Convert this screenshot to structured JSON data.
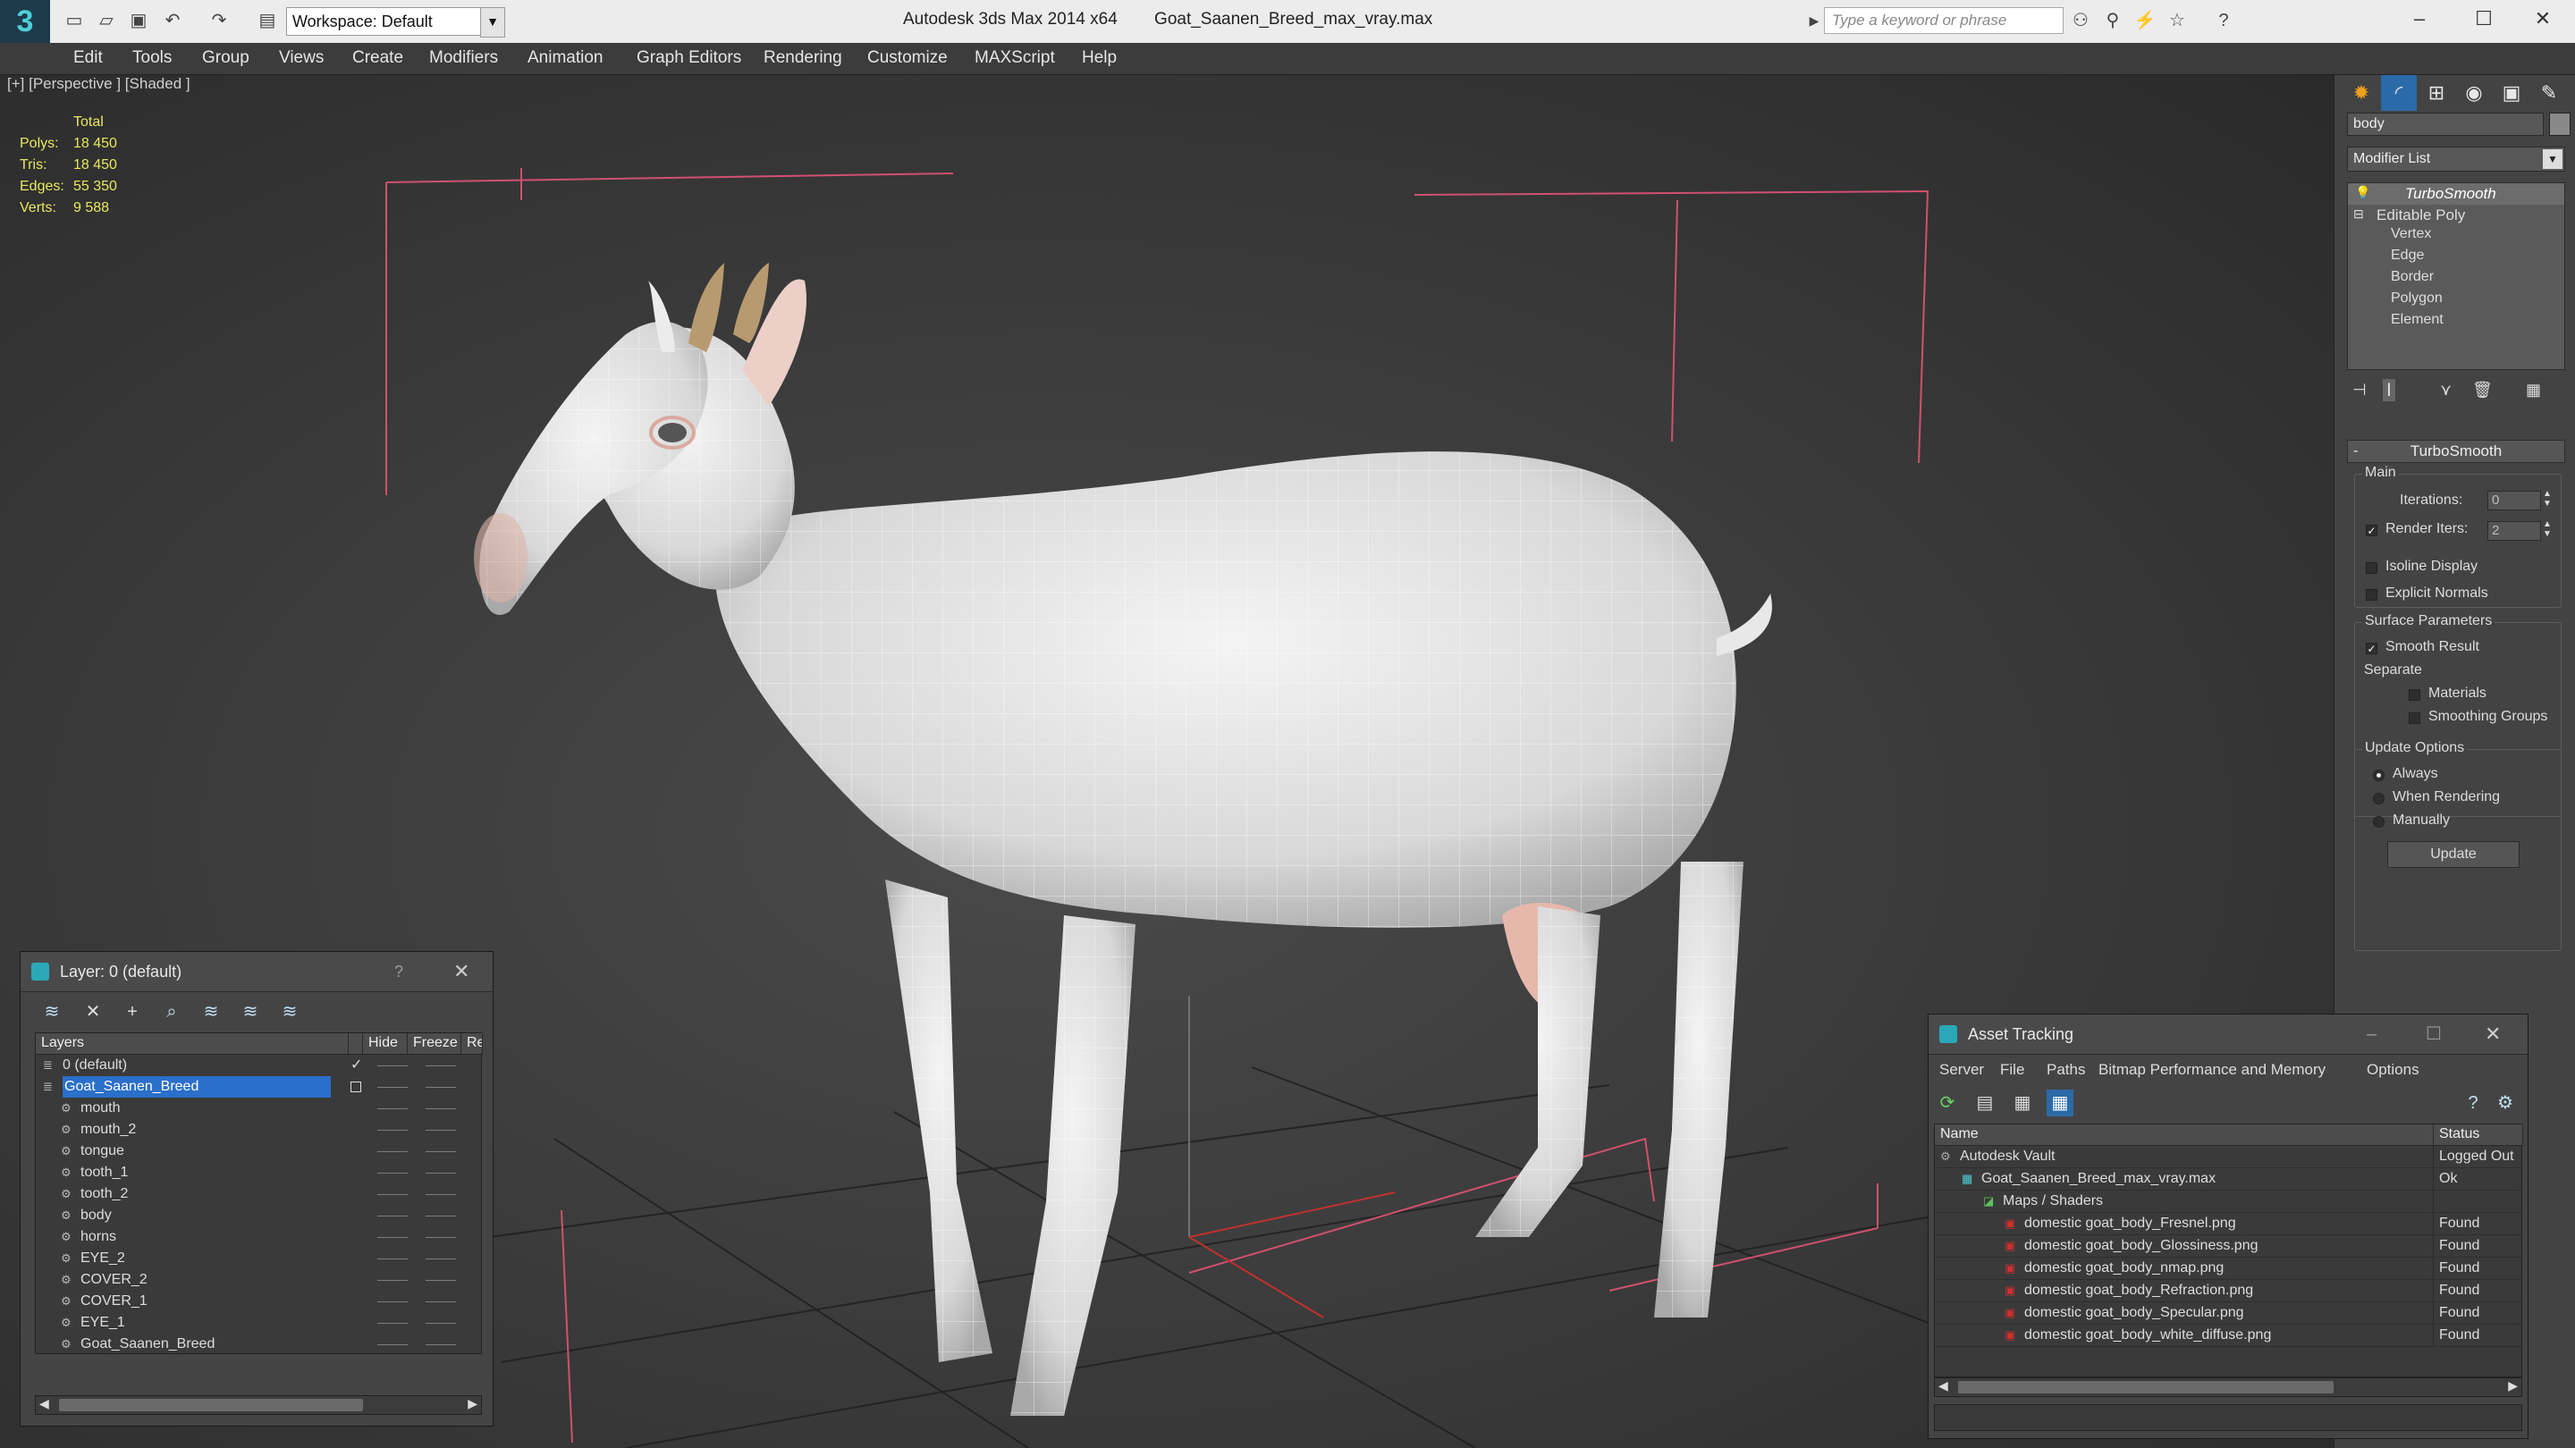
{
  "titlebar": {
    "app": "Autodesk 3ds Max  2014 x64",
    "file": "Goat_Saanen_Breed_max_vray.max",
    "workspace": "Workspace: Default",
    "search_placeholder": "Type a keyword or phrase"
  },
  "menu": [
    "Edit",
    "Tools",
    "Group",
    "Views",
    "Create",
    "Modifiers",
    "Animation",
    "Graph Editors",
    "Rendering",
    "Customize",
    "MAXScript",
    "Help"
  ],
  "viewport": {
    "label": "[+] [Perspective ] [Shaded ]",
    "stats": {
      "header": "Total",
      "rows": [
        {
          "label": "Polys:",
          "value": "18 450"
        },
        {
          "label": "Tris:",
          "value": "18 450"
        },
        {
          "label": "Edges:",
          "value": "55 350"
        },
        {
          "label": "Verts:",
          "value": "9 588"
        }
      ]
    }
  },
  "command_panel": {
    "object_name": "body",
    "modifier_list": "Modifier List",
    "stack": [
      {
        "label": "TurboSmooth",
        "level": 0,
        "italic": true
      },
      {
        "label": "Editable Poly",
        "level": 0
      },
      {
        "label": "Vertex",
        "level": 1
      },
      {
        "label": "Edge",
        "level": 1
      },
      {
        "label": "Border",
        "level": 1
      },
      {
        "label": "Polygon",
        "level": 1
      },
      {
        "label": "Element",
        "level": 1
      }
    ],
    "rollout_title": "TurboSmooth",
    "main_group": "Main",
    "iterations_label": "Iterations:",
    "iterations_value": "0",
    "render_iters_label": "Render Iters:",
    "render_iters_value": "2",
    "isoline_label": "Isoline Display",
    "explicit_normals_label": "Explicit Normals",
    "surface_group": "Surface Parameters",
    "smooth_result_label": "Smooth Result",
    "separate_label": "Separate",
    "materials_label": "Materials",
    "smoothing_groups_label": "Smoothing Groups",
    "update_group": "Update Options",
    "always_label": "Always",
    "when_rendering_label": "When Rendering",
    "manually_label": "Manually",
    "update_button": "Update"
  },
  "layer_window": {
    "title": "Layer: 0 (default)",
    "help": "?",
    "columns": [
      "Layers",
      "Hide",
      "Freeze",
      "Re"
    ],
    "rows": [
      {
        "name": "0 (default)",
        "level": 0,
        "type": "layer",
        "current": true
      },
      {
        "name": "Goat_Saanen_Breed",
        "level": 0,
        "type": "layer",
        "selected": true
      },
      {
        "name": "mouth",
        "level": 1,
        "type": "object"
      },
      {
        "name": "mouth_2",
        "level": 1,
        "type": "object"
      },
      {
        "name": "tongue",
        "level": 1,
        "type": "object"
      },
      {
        "name": "tooth_1",
        "level": 1,
        "type": "object"
      },
      {
        "name": "tooth_2",
        "level": 1,
        "type": "object"
      },
      {
        "name": "body",
        "level": 1,
        "type": "object"
      },
      {
        "name": "horns",
        "level": 1,
        "type": "object"
      },
      {
        "name": "EYE_2",
        "level": 1,
        "type": "object"
      },
      {
        "name": "COVER_2",
        "level": 1,
        "type": "object"
      },
      {
        "name": "COVER_1",
        "level": 1,
        "type": "object"
      },
      {
        "name": "EYE_1",
        "level": 1,
        "type": "object"
      },
      {
        "name": "Goat_Saanen_Breed",
        "level": 1,
        "type": "object"
      }
    ]
  },
  "asset_window": {
    "title": "Asset Tracking",
    "menu": [
      "Server",
      "File",
      "Paths",
      "Bitmap Performance and Memory",
      "Options"
    ],
    "columns": [
      "Name",
      "Status"
    ],
    "rows": [
      {
        "name": "Autodesk Vault",
        "status": "Logged Out",
        "level": 0
      },
      {
        "name": "Goat_Saanen_Breed_max_vray.max",
        "status": "Ok",
        "level": 1
      },
      {
        "name": "Maps / Shaders",
        "status": "",
        "level": 2
      },
      {
        "name": "domestic goat_body_Fresnel.png",
        "status": "Found",
        "level": 3
      },
      {
        "name": "domestic goat_body_Glossiness.png",
        "status": "Found",
        "level": 3
      },
      {
        "name": "domestic goat_body_nmap.png",
        "status": "Found",
        "level": 3
      },
      {
        "name": "domestic goat_body_Refraction.png",
        "status": "Found",
        "level": 3
      },
      {
        "name": "domestic goat_body_Specular.png",
        "status": "Found",
        "level": 3
      },
      {
        "name": "domestic goat_body_white_diffuse.png",
        "status": "Found",
        "level": 3
      }
    ]
  },
  "colors": {
    "accent_selected": "#2a6fc9",
    "stats_text": "#e8e860",
    "bbox_lines": "#d05070",
    "file_icon": "#d03030"
  }
}
